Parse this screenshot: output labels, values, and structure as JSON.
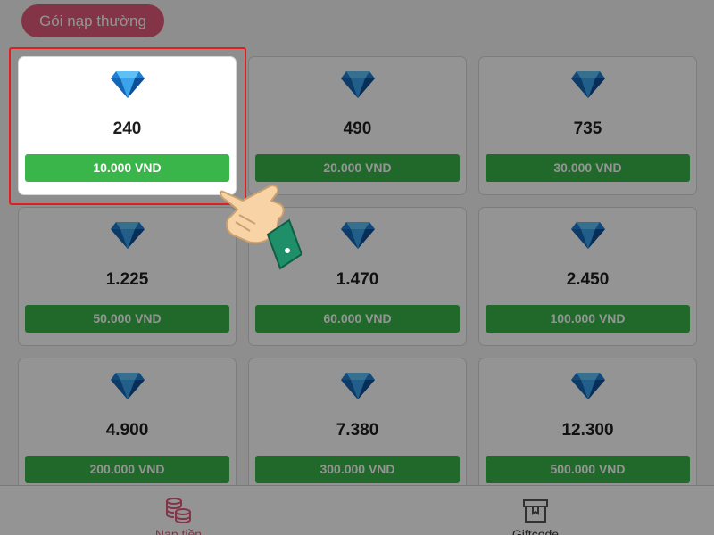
{
  "header": {
    "tab_label": "Gói nạp thường"
  },
  "packages": [
    {
      "amount": "240",
      "price": "10.000 VND"
    },
    {
      "amount": "490",
      "price": "20.000 VND"
    },
    {
      "amount": "735",
      "price": "30.000 VND"
    },
    {
      "amount": "1.225",
      "price": "50.000 VND"
    },
    {
      "amount": "1.470",
      "price": "60.000 VND"
    },
    {
      "amount": "2.450",
      "price": "100.000 VND"
    },
    {
      "amount": "4.900",
      "price": "200.000 VND"
    },
    {
      "amount": "7.380",
      "price": "300.000 VND"
    },
    {
      "amount": "12.300",
      "price": "500.000 VND"
    }
  ],
  "bottom_nav": [
    {
      "label": "Nạp tiền",
      "icon": "coins-icon"
    },
    {
      "label": "Giftcode",
      "icon": "gift-box-icon"
    }
  ],
  "colors": {
    "accent_pink": "#e25a7a",
    "price_green": "#3ab54a",
    "highlight_red": "#e0201f",
    "gem_blue": "#1f7fd6"
  }
}
